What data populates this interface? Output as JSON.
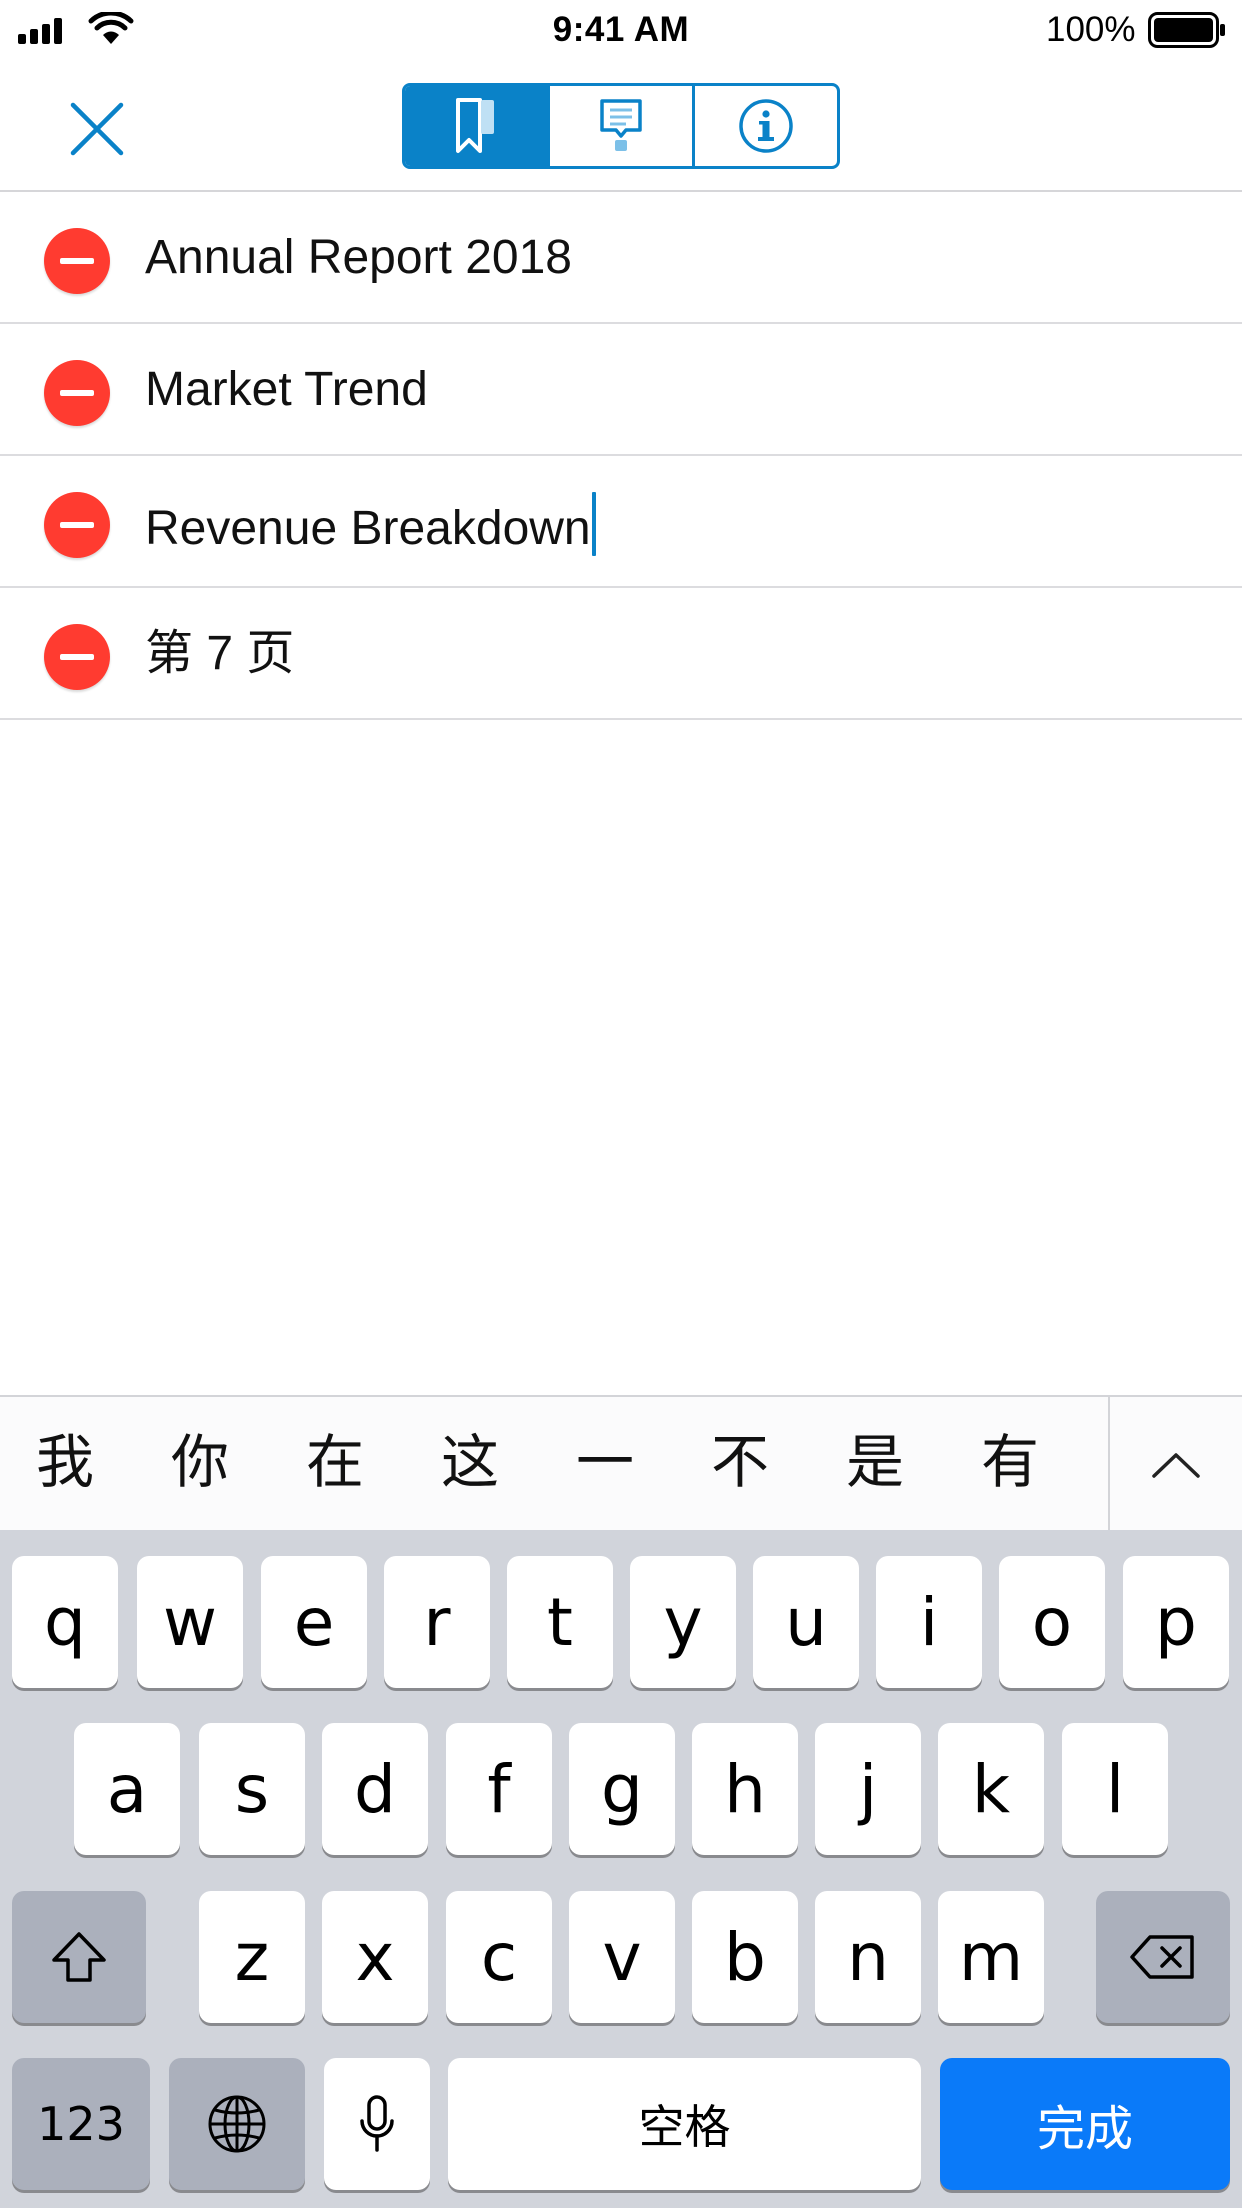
{
  "status_bar": {
    "time": "9:41 AM",
    "battery": "100%"
  },
  "nav": {
    "close_icon": "close-icon",
    "tabs": [
      {
        "icon": "bookmark-icon",
        "active": true
      },
      {
        "icon": "comment-icon",
        "active": false
      },
      {
        "icon": "info-icon",
        "active": false
      }
    ],
    "accent_color": "#0a82c8"
  },
  "bookmarks": [
    {
      "title": "Annual Report 2018"
    },
    {
      "title": "Market Trend"
    },
    {
      "title": "Revenue Breakdown",
      "editing": true
    },
    {
      "title": "第 7 页"
    }
  ],
  "keyboard": {
    "candidates": [
      "我",
      "你",
      "在",
      "这",
      "一",
      "不",
      "是",
      "有"
    ],
    "row1": [
      "q",
      "w",
      "e",
      "r",
      "t",
      "y",
      "u",
      "i",
      "o",
      "p"
    ],
    "row2": [
      "a",
      "s",
      "d",
      "f",
      "g",
      "h",
      "j",
      "k",
      "l"
    ],
    "row3": [
      "z",
      "x",
      "c",
      "v",
      "b",
      "n",
      "m"
    ],
    "numbers_label": "123",
    "space_label": "空格",
    "return_label": "完成",
    "return_color": "#0a7af9",
    "delete_color": "#ff3b30"
  }
}
